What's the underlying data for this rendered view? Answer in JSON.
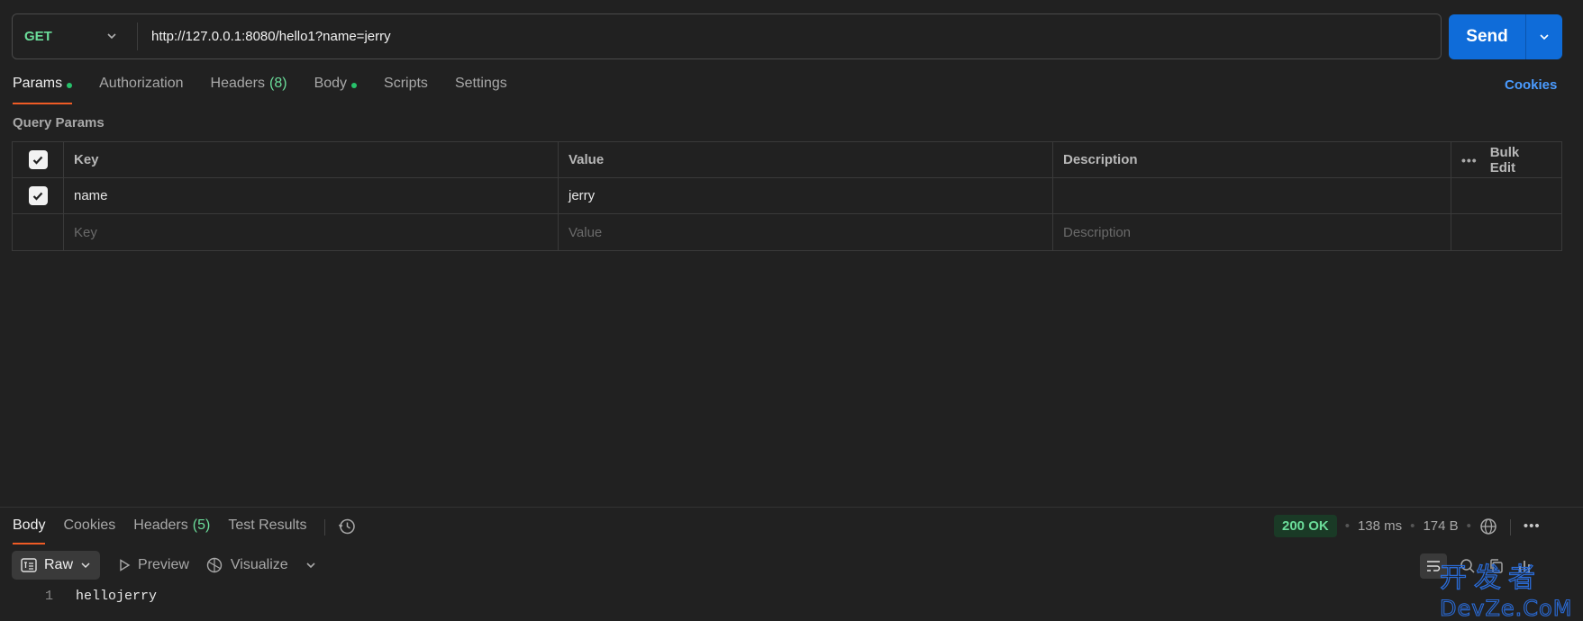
{
  "request": {
    "method": "GET",
    "url": "http://127.0.0.1:8080/hello1?name=jerry",
    "send_label": "Send"
  },
  "request_tabs": [
    {
      "label": "Params",
      "active": true,
      "dot": true
    },
    {
      "label": "Authorization"
    },
    {
      "label": "Headers",
      "count": "(8)"
    },
    {
      "label": "Body",
      "dot": true
    },
    {
      "label": "Scripts"
    },
    {
      "label": "Settings"
    }
  ],
  "cookies_link": "Cookies",
  "query_params": {
    "title": "Query Params",
    "headers": {
      "key": "Key",
      "value": "Value",
      "description": "Description",
      "bulk_edit": "Bulk Edit"
    },
    "rows": [
      {
        "checked": true,
        "key": "name",
        "value": "jerry",
        "description": ""
      }
    ],
    "placeholders": {
      "key": "Key",
      "value": "Value",
      "description": "Description"
    }
  },
  "response": {
    "tabs": [
      {
        "label": "Body",
        "active": true
      },
      {
        "label": "Cookies"
      },
      {
        "label": "Headers",
        "count": "(5)"
      },
      {
        "label": "Test Results"
      }
    ],
    "status": "200 OK",
    "time": "138 ms",
    "size": "174 B",
    "view_modes": {
      "raw": "Raw",
      "preview": "Preview",
      "visualize": "Visualize"
    },
    "body_lines": [
      {
        "number": "1",
        "text": "hellojerry"
      }
    ]
  },
  "watermark": {
    "line1": "开发者",
    "line2": "DevZe.CoM"
  },
  "colors": {
    "accent": "#0f6cd9",
    "active_tab": "#ef5b25",
    "success": "#6bdd9a",
    "link": "#4a9bff"
  }
}
